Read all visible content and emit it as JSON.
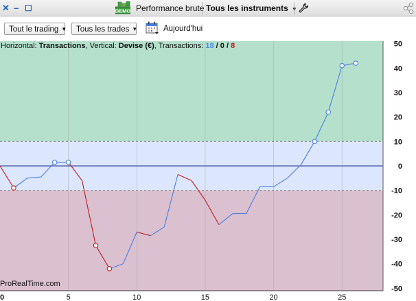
{
  "titlebar": {
    "performance_label": "Performance brute",
    "instruments_label": "Tous les instruments",
    "demo_badge": "DEMO"
  },
  "toolbar": {
    "trading_filter": "Tout le trading",
    "trades_filter": "Tous les trades",
    "today_label": "Aujourd'hui"
  },
  "info": {
    "horizontal_label": "Horizontal: ",
    "horizontal_value": "Transactions",
    "vertical_label": ", Vertical: ",
    "vertical_value": "Devise (€)",
    "transactions_label": ", Transactions: ",
    "winning": "18",
    "sep1": " / ",
    "neutral": "0",
    "sep2": " / ",
    "losing": "8"
  },
  "watermark": "ProRealTime.com",
  "colors": {
    "profit_zone": "#b4e0cc",
    "neutral_zone": "#dce6fc",
    "loss_zone": "#dbc0d0",
    "up_line": "#4a7fe0",
    "down_line": "#bb1d1d",
    "winning_count": "#4a8fe8",
    "losing_count": "#cc1111"
  },
  "chart_data": {
    "type": "line",
    "x": [
      0,
      1,
      2,
      3,
      4,
      5,
      6,
      7,
      8,
      9,
      10,
      11,
      12,
      13,
      14,
      15,
      16,
      17,
      18,
      19,
      20,
      21,
      22,
      23,
      24,
      25,
      26
    ],
    "y": [
      0,
      -9,
      -5,
      -4.5,
      1.5,
      1.5,
      -6,
      -32.5,
      -42,
      -40,
      -27,
      -28.5,
      -25,
      -3.5,
      -6,
      -14,
      -24,
      -19.5,
      -19.5,
      -8.5,
      -8.5,
      -5,
      0.5,
      10,
      22,
      41,
      42
    ],
    "markers": [
      1,
      4,
      5,
      7,
      8,
      23,
      24,
      25,
      26
    ],
    "xlim": [
      0,
      28
    ],
    "ylim": [
      -51,
      51
    ],
    "x_ticks": [
      0,
      5,
      10,
      15,
      20,
      25
    ],
    "y_ticks": [
      50,
      40,
      30,
      20,
      10,
      0,
      -10,
      -20,
      -30,
      -40,
      -50
    ],
    "bands": [
      {
        "from": 10,
        "to": 51,
        "color": "#b4e0cc"
      },
      {
        "from": -10,
        "to": 10,
        "color": "#dce6fc"
      },
      {
        "from": -51,
        "to": -10,
        "color": "#dbc0d0"
      }
    ],
    "grid": true
  }
}
